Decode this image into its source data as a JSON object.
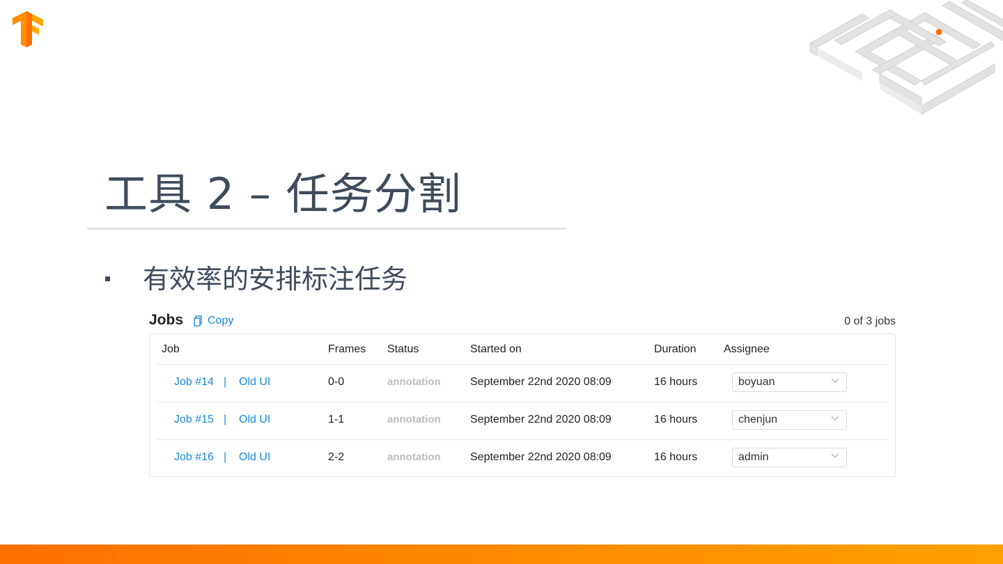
{
  "slide": {
    "title": "工具 2 – 任务分割",
    "bullet": "有效率的安排标注任务"
  },
  "jobs": {
    "title": "Jobs",
    "copy_label": "Copy",
    "count": "0 of 3 jobs",
    "columns": {
      "job": "Job",
      "frames": "Frames",
      "status": "Status",
      "started_on": "Started on",
      "duration": "Duration",
      "assignee": "Assignee"
    },
    "rows": [
      {
        "job": "Job #14",
        "sep": "|",
        "old_ui": "Old UI",
        "frames": "0-0",
        "status": "annotation",
        "started": "September 22nd 2020 08:09",
        "duration": "16 hours",
        "assignee": "boyuan"
      },
      {
        "job": "Job #15",
        "sep": "|",
        "old_ui": "Old UI",
        "frames": "1-1",
        "status": "annotation",
        "started": "September 22nd 2020 08:09",
        "duration": "16 hours",
        "assignee": "chenjun"
      },
      {
        "job": "Job #16",
        "sep": "|",
        "old_ui": "Old UI",
        "frames": "2-2",
        "status": "annotation",
        "started": "September 22nd 2020 08:09",
        "duration": "16 hours",
        "assignee": "admin"
      }
    ]
  },
  "colors": {
    "title": "#3f4b5b",
    "link": "#1a8bd8",
    "accent_orange": "#ff8a00",
    "status_gray": "#bdbdbd"
  },
  "icons": {
    "logo": "tensorflow-logo",
    "copy": "copy-icon",
    "dropdown": "chevron-down-icon"
  }
}
